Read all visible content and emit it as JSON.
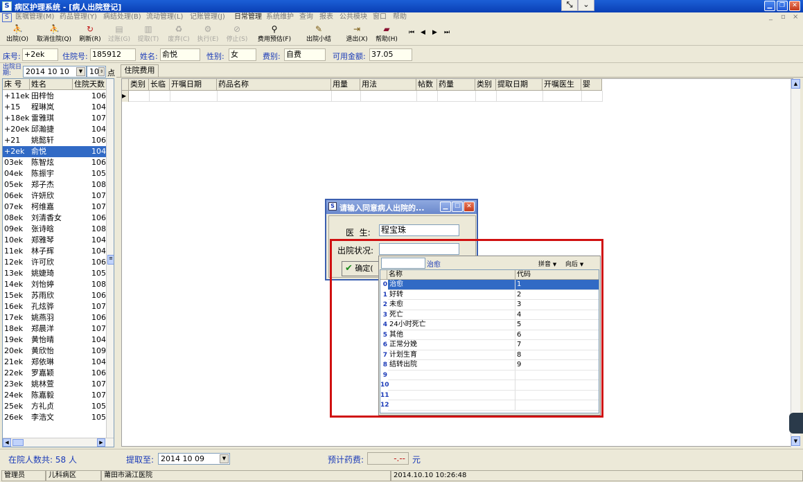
{
  "window": {
    "title": "病区护理系统 - [病人出院登记]",
    "icon_char": "S"
  },
  "menu": {
    "items": [
      "医嘱管理(M)",
      "药品管理(Y)",
      "病结处理(B)",
      "流动管理(L)",
      "记账管理(J)",
      "日常管理",
      "系统维护",
      "查询",
      "报表",
      "公共模块",
      "窗口",
      "帮助"
    ]
  },
  "toolbar": {
    "items": [
      {
        "label": "出院(O)",
        "icon": "walker-icon",
        "glyph": "⛹",
        "color": "#2a8a2a",
        "enabled": true
      },
      {
        "label": "取消住院(Q)",
        "icon": "walker-icon",
        "glyph": "⛹",
        "color": "#2a8a2a",
        "enabled": true
      },
      {
        "label": "刷新(R)",
        "icon": "refresh-icon",
        "glyph": "↻",
        "color": "#c01818",
        "enabled": true
      },
      {
        "label": "过账(G)",
        "icon": "post-icon",
        "glyph": "▤",
        "color": "#9a9a9a",
        "enabled": false
      },
      {
        "label": "提取(T)",
        "icon": "extract-icon",
        "glyph": "▥",
        "color": "#9a9a9a",
        "enabled": false
      },
      {
        "label": "废弃(C)",
        "icon": "trash-icon",
        "glyph": "♻",
        "color": "#9a9a9a",
        "enabled": false
      },
      {
        "label": "执行(E)",
        "icon": "execute-icon",
        "glyph": "⚙",
        "color": "#9a9a9a",
        "enabled": false
      },
      {
        "label": "停止(S)",
        "icon": "stop-icon",
        "glyph": "⊘",
        "color": "#9a9a9a",
        "enabled": false
      },
      {
        "label": "费用预估(F)",
        "icon": "estimate-icon",
        "glyph": "⚲",
        "color": "#333",
        "enabled": true
      },
      {
        "label": "出院小结",
        "icon": "summary-icon",
        "glyph": "✎",
        "color": "#7a5a10",
        "enabled": true
      },
      {
        "label": "退出(X)",
        "icon": "exit-icon",
        "glyph": "⇥",
        "color": "#7a5a10",
        "enabled": true
      },
      {
        "label": "帮助(H)",
        "icon": "help-book-icon",
        "glyph": "▰",
        "color": "#8a1030",
        "enabled": true
      }
    ],
    "nav_glyphs": [
      "⏮",
      "◀",
      "▶",
      "⏭"
    ]
  },
  "patient": {
    "bed_label": "床号:",
    "bed_value": "+2ek",
    "hosp_no_label": "住院号:",
    "hosp_no_value": "185912",
    "name_label": "姓名:",
    "name_value": "俞悦",
    "sex_label": "性别:",
    "sex_value": "女",
    "fee_type_label": "费别:",
    "fee_type_value": "自费",
    "available_label": "可用金额:",
    "available_value": "37.05"
  },
  "left": {
    "date_label": "出院日期:",
    "date_value": "2014 10 10",
    "hour_value": "10",
    "hour_unit": "点",
    "columns": [
      "床 号",
      "姓名",
      "住院天数"
    ],
    "rows": [
      {
        "bed": "+11ek",
        "name": "田梓怡",
        "days": "106"
      },
      {
        "bed": "+15",
        "name": "程琳岚",
        "days": "104"
      },
      {
        "bed": "+18ek",
        "name": "雷雅琪",
        "days": "107"
      },
      {
        "bed": "+20ek",
        "name": "邱瀚捷",
        "days": "104"
      },
      {
        "bed": "+21",
        "name": "姚懿轩",
        "days": "106"
      },
      {
        "bed": "+2ek",
        "name": "俞悦",
        "days": "104",
        "selected": true
      },
      {
        "bed": "03ek",
        "name": "陈智炫",
        "days": "106"
      },
      {
        "bed": "04ek",
        "name": "陈振宇",
        "days": "105"
      },
      {
        "bed": "05ek",
        "name": "郑子杰",
        "days": "108"
      },
      {
        "bed": "06ek",
        "name": "许妍欣",
        "days": "107"
      },
      {
        "bed": "07ek",
        "name": "柯维嘉",
        "days": "107"
      },
      {
        "bed": "08ek",
        "name": "刘清香女",
        "days": "106"
      },
      {
        "bed": "09ek",
        "name": "张诗晗",
        "days": "108"
      },
      {
        "bed": "10ek",
        "name": "郑雅琴",
        "days": "104"
      },
      {
        "bed": "11ek",
        "name": "林子辉",
        "days": "104"
      },
      {
        "bed": "12ek",
        "name": "许可欣",
        "days": "106"
      },
      {
        "bed": "13ek",
        "name": "姚婕琦",
        "days": "105"
      },
      {
        "bed": "14ek",
        "name": "刘怡婷",
        "days": "108"
      },
      {
        "bed": "15ek",
        "name": "苏雨欣",
        "days": "106"
      },
      {
        "bed": "16ek",
        "name": "孔炫骅",
        "days": "107"
      },
      {
        "bed": "17ek",
        "name": "姚燕羽",
        "days": "106"
      },
      {
        "bed": "18ek",
        "name": "郑晨洋",
        "days": "107"
      },
      {
        "bed": "19ek",
        "name": "黄怡晴",
        "days": "104"
      },
      {
        "bed": "20ek",
        "name": "黄欣怡",
        "days": "109"
      },
      {
        "bed": "21ek",
        "name": "郑依琳",
        "days": "104"
      },
      {
        "bed": "22ek",
        "name": "罗嘉颖",
        "days": "106"
      },
      {
        "bed": "23ek",
        "name": "姚林萱",
        "days": "107"
      },
      {
        "bed": "24ek",
        "name": "陈嘉毅",
        "days": "107"
      },
      {
        "bed": "25ek",
        "name": "方礼贞",
        "days": "105"
      },
      {
        "bed": "26ek",
        "name": "李浩文",
        "days": "105"
      }
    ]
  },
  "main": {
    "tab": "住院费用",
    "columns": [
      "类别",
      "长临",
      "开嘱日期",
      "药品名称",
      "用量",
      "用法",
      "帖数",
      "药量",
      "类别",
      "提取日期",
      "开嘱医生",
      "婴"
    ]
  },
  "bottom": {
    "count_text": "在院人数共: 58 人",
    "extract_label": "提取至:",
    "extract_date": "2014 10 09",
    "estimate_label": "预计药费:",
    "estimate_value": "-.--",
    "currency": "元"
  },
  "status": {
    "user": "管理员",
    "ward": "儿科病区",
    "hospital": "莆田市涵江医院",
    "datetime": "2014.10.10 10:26:48"
  },
  "dialog": {
    "title": "请输入同意病人出院的...",
    "doctor_label": "医  生:",
    "doctor_value": "程宝珠",
    "status_label": "出院状况:",
    "status_value": "",
    "confirm_label": "确定(",
    "confirm_icon": "checkmark-icon"
  },
  "popup": {
    "search_value": "",
    "selected_text": "治愈",
    "option1": "拼音",
    "option2": "向后",
    "columns": [
      "名称",
      "代码"
    ],
    "rows": [
      {
        "name": "治愈",
        "code": "1",
        "selected": true
      },
      {
        "name": "好转",
        "code": "2"
      },
      {
        "name": "未愈",
        "code": "3"
      },
      {
        "name": "死亡",
        "code": "4"
      },
      {
        "name": "24小时死亡",
        "code": "5"
      },
      {
        "name": "其他",
        "code": "6"
      },
      {
        "name": "正常分娩",
        "code": "7"
      },
      {
        "name": "计划生育",
        "code": "8"
      },
      {
        "name": "结转出院",
        "code": "9"
      },
      {
        "name": "",
        "code": ""
      },
      {
        "name": "",
        "code": ""
      },
      {
        "name": "",
        "code": ""
      },
      {
        "name": "",
        "code": ""
      }
    ],
    "row_numbers": [
      "0",
      "1",
      "2",
      "3",
      "4",
      "5",
      "6",
      "7",
      "8",
      "9",
      "10",
      "11",
      "12"
    ]
  },
  "highlight_color": "#d01010"
}
